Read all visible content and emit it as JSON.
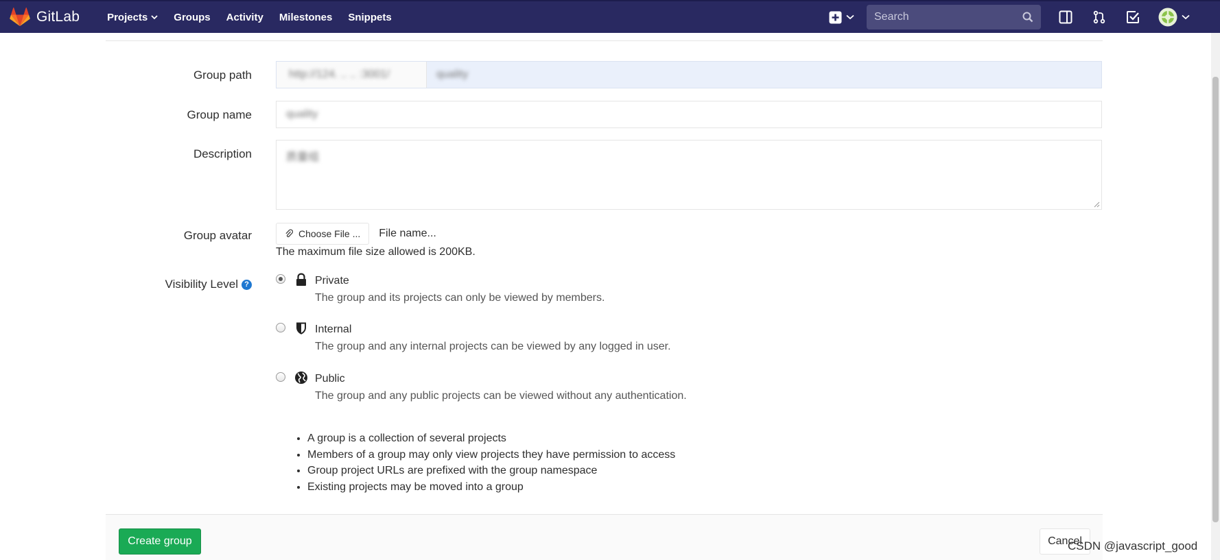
{
  "navbar": {
    "brand": "GitLab",
    "links": [
      {
        "label": "Projects",
        "dropdown": true
      },
      {
        "label": "Groups"
      },
      {
        "label": "Activity"
      },
      {
        "label": "Milestones"
      },
      {
        "label": "Snippets"
      }
    ],
    "search_placeholder": "Search",
    "colors": {
      "background": "#292961",
      "search_bg": "#4b4b7c",
      "logo": "#fc6d26"
    }
  },
  "form": {
    "group_path": {
      "label": "Group path",
      "prefix": "http://124.  ..  .. :3001/",
      "value": "quality"
    },
    "group_name": {
      "label": "Group name",
      "value": "quality"
    },
    "description": {
      "label": "Description",
      "value": "质量组"
    },
    "group_avatar": {
      "label": "Group avatar",
      "choose_button": "Choose File ...",
      "file_name": "File name...",
      "help": "The maximum file size allowed is 200KB."
    },
    "visibility": {
      "label": "Visibility Level",
      "help_icon": "question-circle-icon",
      "selected": "Private",
      "options": [
        {
          "title": "Private",
          "icon": "lock-icon",
          "description": "The group and its projects can only be viewed by members."
        },
        {
          "title": "Internal",
          "icon": "shield-icon",
          "description": "The group and any internal projects can be viewed by any logged in user."
        },
        {
          "title": "Public",
          "icon": "globe-icon",
          "description": "The group and any public projects can be viewed without any authentication."
        }
      ]
    },
    "info_bullets": [
      "A group is a collection of several projects",
      "Members of a group may only view projects they have permission to access",
      "Group project URLs are prefixed with the group namespace",
      "Existing projects may be moved into a group"
    ],
    "actions": {
      "create": "Create group",
      "cancel": "Cancel",
      "create_color": "#1aaa55"
    }
  },
  "watermark": "CSDN @javascript_good"
}
